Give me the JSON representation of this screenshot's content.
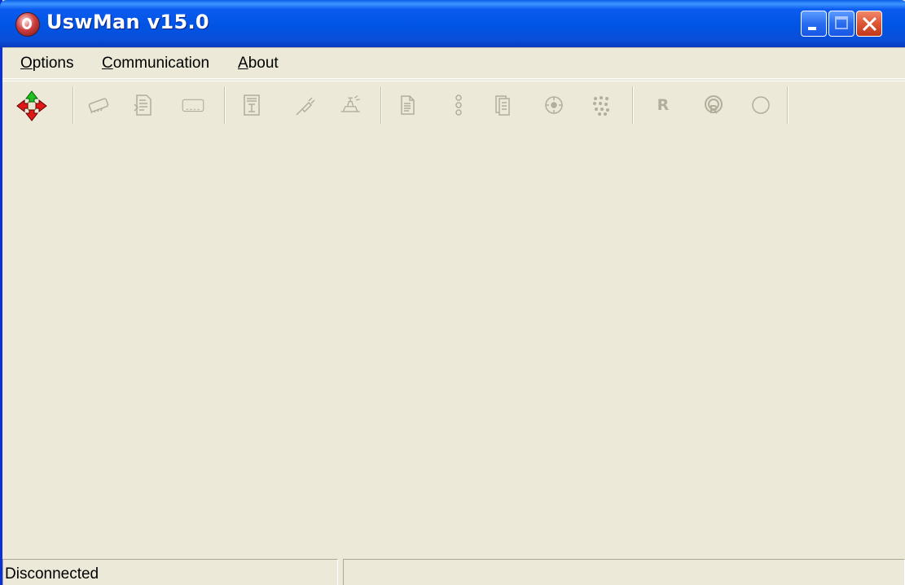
{
  "window": {
    "title": "UswMan v15.0"
  },
  "menu": {
    "options": {
      "accel": "O",
      "rest": "ptions"
    },
    "communication": {
      "accel": "C",
      "rest": "ommunication"
    },
    "about": {
      "accel": "A",
      "rest": "bout"
    }
  },
  "toolbar": {
    "tools": [
      {
        "name": "move-arrows-icon",
        "enabled": true
      },
      {
        "name": "chip-icon",
        "enabled": false
      },
      {
        "name": "document-scan-icon",
        "enabled": false
      },
      {
        "name": "card-icon",
        "enabled": false
      },
      {
        "name": "calendar-doc-icon",
        "enabled": false
      },
      {
        "name": "plug-icon",
        "enabled": false
      },
      {
        "name": "hand-stamp-icon",
        "enabled": false
      },
      {
        "name": "page-icon",
        "enabled": false
      },
      {
        "name": "three-dots-icon",
        "enabled": false
      },
      {
        "name": "copy-pages-icon",
        "enabled": false
      },
      {
        "name": "dial-icon",
        "enabled": false
      },
      {
        "name": "keypad-icon",
        "enabled": false
      },
      {
        "name": "r-letter-icon",
        "label": "R",
        "enabled": false
      },
      {
        "name": "r-circle-icon",
        "enabled": false
      },
      {
        "name": "circle-icon",
        "enabled": false
      }
    ]
  },
  "statusbar": {
    "connection_status": "Disconnected",
    "secondary": ""
  },
  "colors": {
    "face": "#ece9d8",
    "titlebar": "#0054e3",
    "disabled_icon": "#b1ae9b"
  }
}
